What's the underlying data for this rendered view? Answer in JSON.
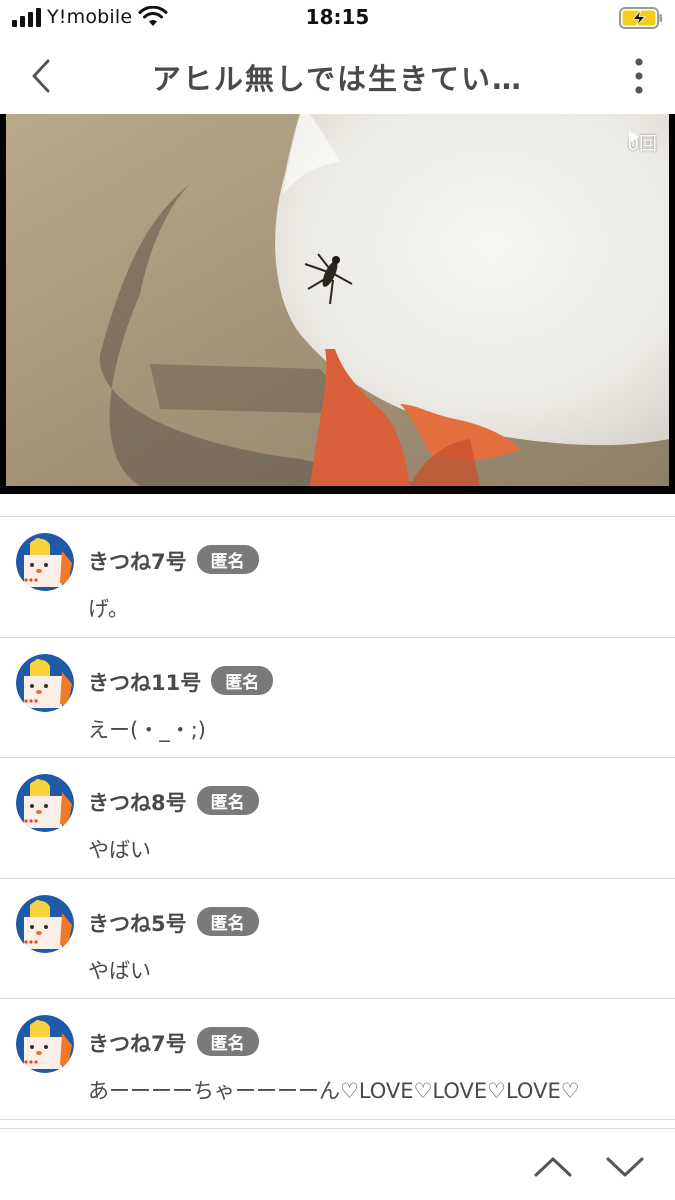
{
  "status": {
    "carrier": "Y!mobile",
    "time": "18:15"
  },
  "header": {
    "title": "アヒル無しでは生きてい…",
    "back_icon": "chevron-left-icon",
    "more_icon": "vertical-dots-icon"
  },
  "video": {
    "play_count": "0回"
  },
  "comments": [
    {
      "user": "きつね7号",
      "badge": "匿名",
      "text": "げ。"
    },
    {
      "user": "きつね11号",
      "badge": "匿名",
      "text": "えー(・_・;)"
    },
    {
      "user": "きつね8号",
      "badge": "匿名",
      "text": "やばい"
    },
    {
      "user": "きつね5号",
      "badge": "匿名",
      "text": "やばい"
    },
    {
      "user": "きつね7号",
      "badge": "匿名",
      "text": "あーーーーちゃーーーーん♡LOVE♡LOVE♡LOVE♡"
    }
  ],
  "colors": {
    "text": "#4a4a4a",
    "badge_bg": "#7a7a7a",
    "divider": "#dcdcdc",
    "avatar_blue": "#1e5aa8",
    "avatar_orange": "#f07a2a",
    "duck_foot": "#e8643a"
  }
}
